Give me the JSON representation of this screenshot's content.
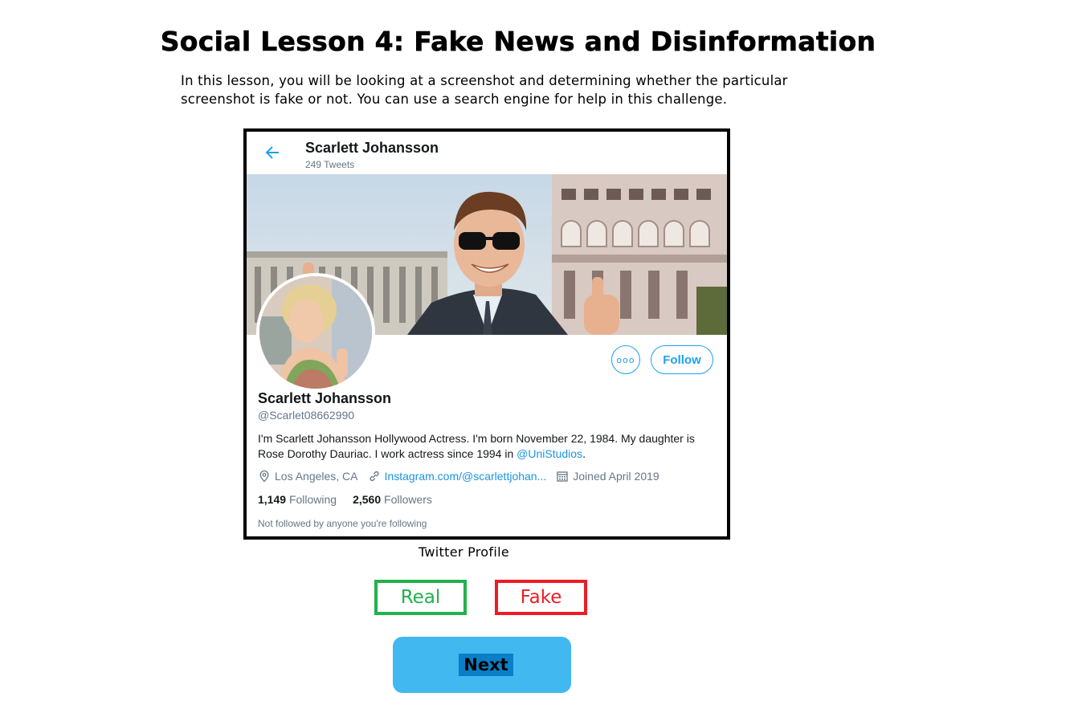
{
  "lesson": {
    "title": "Social Lesson 4: Fake News and Disinformation",
    "intro_line1": "In this lesson, you will be looking at a screenshot and determining whether the particular",
    "intro_line2": "screenshot is fake or not. You can use a search engine for help in this challenge.",
    "caption": "Twitter Profile"
  },
  "profile": {
    "header_name": "Scarlett Johansson",
    "tweet_count": "249 Tweets",
    "name": "Scarlett Johansson",
    "handle": "@Scarlet08662990",
    "bio_text": "I'm Scarlett Johansson Hollywood Actress. I'm born November 22, 1984. My daughter is Rose Dorothy Dauriac. I work actress since 1994 in ",
    "bio_mention": "@UniStudios",
    "bio_end": ".",
    "location": "Los Angeles, CA",
    "website": "Instagram.com/@scarlettjohan...",
    "joined": "Joined April 2019",
    "following_count": "1,149",
    "following_label": "Following",
    "followers_count": "2,560",
    "followers_label": "Followers",
    "follow_note": "Not followed by anyone you're following",
    "follow_label": "Follow",
    "more_label": "ooo"
  },
  "choices": {
    "real_label": "Real",
    "fake_label": "Fake",
    "next_label": "Next"
  },
  "colors": {
    "twitter_blue": "#1da1f2",
    "real_green": "#22b14c",
    "fake_red": "#ed1c24",
    "next_button": "#41b8ef"
  },
  "icons": [
    "back-arrow-icon",
    "location-pin-icon",
    "link-icon",
    "calendar-icon",
    "more-options-icon"
  ]
}
